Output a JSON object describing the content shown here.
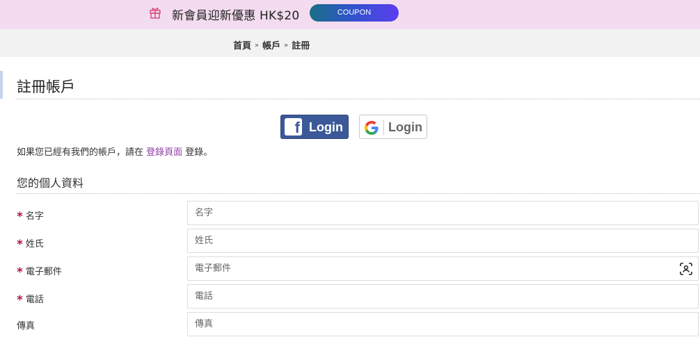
{
  "promo": {
    "text": "新會員迎新優惠 HK$20",
    "button": "COUPON",
    "icon": "gift-icon"
  },
  "breadcrumb": {
    "items": [
      "首頁",
      "帳戶",
      "註冊"
    ],
    "separator": "»"
  },
  "page": {
    "title": "註冊帳戶"
  },
  "social": {
    "facebook_label": "Login",
    "google_label": "Login"
  },
  "login_prompt": {
    "before": "如果您已經有我們的帳戶，請在 ",
    "link": "登錄頁面",
    "after": " 登錄。"
  },
  "section": {
    "title": "您的個人資料"
  },
  "form": {
    "required_mark": "*",
    "fields": [
      {
        "label": "名字",
        "placeholder": "名字",
        "required": true
      },
      {
        "label": "姓氏",
        "placeholder": "姓氏",
        "required": true
      },
      {
        "label": "電子郵件",
        "placeholder": "電子郵件",
        "required": true
      },
      {
        "label": "電話",
        "placeholder": "電話",
        "required": true
      },
      {
        "label": "傳真",
        "placeholder": "傳真",
        "required": false
      }
    ]
  },
  "colors": {
    "promo_bg": "#f3dcef",
    "link": "#8e3fa6",
    "required": "#b0144a",
    "facebook": "#3b5998"
  }
}
